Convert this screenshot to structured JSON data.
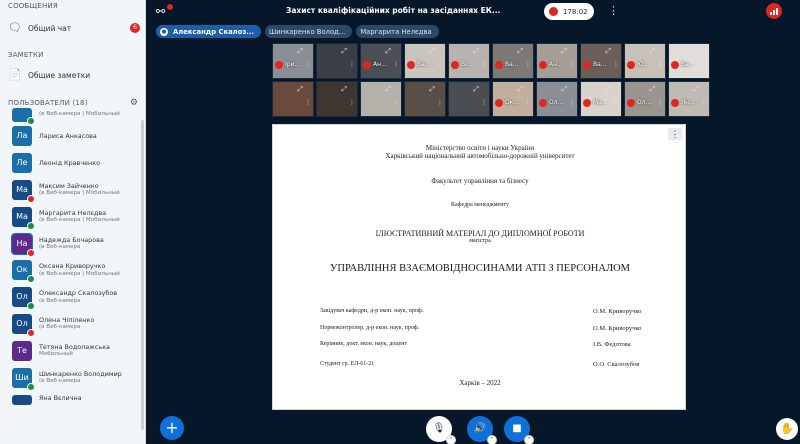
{
  "sidebar": {
    "messages_title": "СООБЩЕНИЯ",
    "public_chat": "Общий чат",
    "unread_count": "6",
    "notes_title": "ЗАМЕТКИ",
    "shared_notes": "Общие заметки",
    "users_title": "ПОЛЬЗОВАТЕЛИ (18)",
    "users": [
      {
        "initials": "",
        "name": "",
        "status": "(в Веб-камера | Мобильный",
        "color": "#1a6fa8",
        "indicator": "green"
      },
      {
        "initials": "Ла",
        "name": "Лариса Анкасова",
        "status": "",
        "color": "#1a6fa8",
        "indicator": ""
      },
      {
        "initials": "Ле",
        "name": "Леонід Кравченко",
        "status": "",
        "color": "#1a6fa8",
        "indicator": ""
      },
      {
        "initials": "Ма",
        "name": "Максим Зайченко",
        "status": "(в Веб-камера | Мобильный",
        "color": "#164b86",
        "indicator": "red"
      },
      {
        "initials": "Ма",
        "name": "Маргарита Нелєдва",
        "status": "(в Веб-камера | Мобильный",
        "color": "#164b86",
        "indicator": "green"
      },
      {
        "initials": "На",
        "name": "Надежда Бочарова",
        "status": "(в Веб-камера",
        "color": "#5b2a8a",
        "indicator": "red"
      },
      {
        "initials": "Ок",
        "name": "Оксана Криворучко",
        "status": "(в Веб-камера | Мобильный",
        "color": "#1a6fa8",
        "indicator": "green"
      },
      {
        "initials": "Ол",
        "name": "Олександр Скалозубов",
        "status": "(в Веб-камера",
        "color": "#164b86",
        "indicator": "green"
      },
      {
        "initials": "Ол",
        "name": "Олена Чіпіленко",
        "status": "(в Веб-камера",
        "color": "#164b86",
        "indicator": "red"
      },
      {
        "initials": "Те",
        "name": "Тетяна Водолажська",
        "status": "Мобильный",
        "color": "#5b2a8a",
        "indicator": ""
      },
      {
        "initials": "Ши",
        "name": "Шинкаренко Володимир",
        "status": "(в Веб-камера",
        "color": "#1a6fa8",
        "indicator": "green"
      },
      {
        "initials": "",
        "name": "Яна Вєлична",
        "status": "",
        "color": "#164b86",
        "indicator": ""
      }
    ]
  },
  "topbar": {
    "title": "Захист кваліфікаційних робіт на засіданнях ЕК...",
    "recording_time": "178:02"
  },
  "talkers": [
    {
      "name": "Александр Скалоз...",
      "state": "active"
    },
    {
      "name": "Шинкаренко Волод...",
      "state": "muted"
    },
    {
      "name": "Маргарита Нелєдва",
      "state": "muted"
    }
  ],
  "video_tiles": [
    {
      "name": "Іри...",
      "bg": "#8a8f96",
      "mic": true
    },
    {
      "name": "",
      "bg": "#3a3f46",
      "mic": false
    },
    {
      "name": "Ан...",
      "bg": "#4b4e55",
      "mic": true
    },
    {
      "name": "Ва...",
      "bg": "#c9c4bd",
      "mic": true
    },
    {
      "name": "Ві...",
      "bg": "#b7b3ae",
      "mic": true
    },
    {
      "name": "Ва...",
      "bg": "#7d7a76",
      "mic": true
    },
    {
      "name": "Ан...",
      "bg": "#a49e96",
      "mic": true
    },
    {
      "name": "Ва...",
      "bg": "#6b5f58",
      "mic": true
    },
    {
      "name": "Ю...",
      "bg": "#c8c1b8",
      "mic": true
    },
    {
      "name": "Ва...",
      "bg": "#e1ded9",
      "mic": true
    },
    {
      "name": "",
      "bg": "#6b4a3e",
      "mic": false
    },
    {
      "name": "",
      "bg": "#3f3631",
      "mic": false
    },
    {
      "name": "",
      "bg": "#b4b0aa",
      "mic": false
    },
    {
      "name": "",
      "bg": "#5a4f47",
      "mic": false
    },
    {
      "name": "",
      "bg": "#4a4d52",
      "mic": false
    },
    {
      "name": "Ок...",
      "bg": "#c2ae9c",
      "mic": true
    },
    {
      "name": "Ол...",
      "bg": "#8a8f96",
      "mic": true
    },
    {
      "name": "Ма...",
      "bg": "#d8d3cc",
      "mic": true
    },
    {
      "name": "Ол...",
      "bg": "#9b9590",
      "mic": true
    },
    {
      "name": "Ян...",
      "bg": "#bfbab3",
      "mic": true
    }
  ],
  "slide": {
    "line1": "Міністерство освіти і науки України",
    "line2": "Харківський національний автомобільно-дорожній університет",
    "faculty": "Факультет управління та бізнесу",
    "department": "Кафедра менеджменту",
    "material": "ІЛЮСТРАТИВНИЙ МАТЕРІАЛ ДО ДИПЛОМНОЇ РОБОТИ",
    "degree": "магістра",
    "topic": "УПРАВЛІННЯ ВЗАЄМОВІДНОСИНАМИ АТП З ПЕРСОНАЛОМ",
    "roles": [
      {
        "role": "Завідувач кафедри, д-р екон. наук, проф.",
        "person": "О.М. Криворучко"
      },
      {
        "role": "Нормоконтролер, д-р екон. наук, проф.",
        "person": "О.М. Криворучко"
      },
      {
        "role": "Керівник, докт. екон. наук, доцент",
        "person": "І.В. Федотова"
      },
      {
        "role": "Студент гр. ЕЛ-61-21",
        "person": "О.О. Скалозубов"
      }
    ],
    "city_year": "Харків – 2022"
  }
}
